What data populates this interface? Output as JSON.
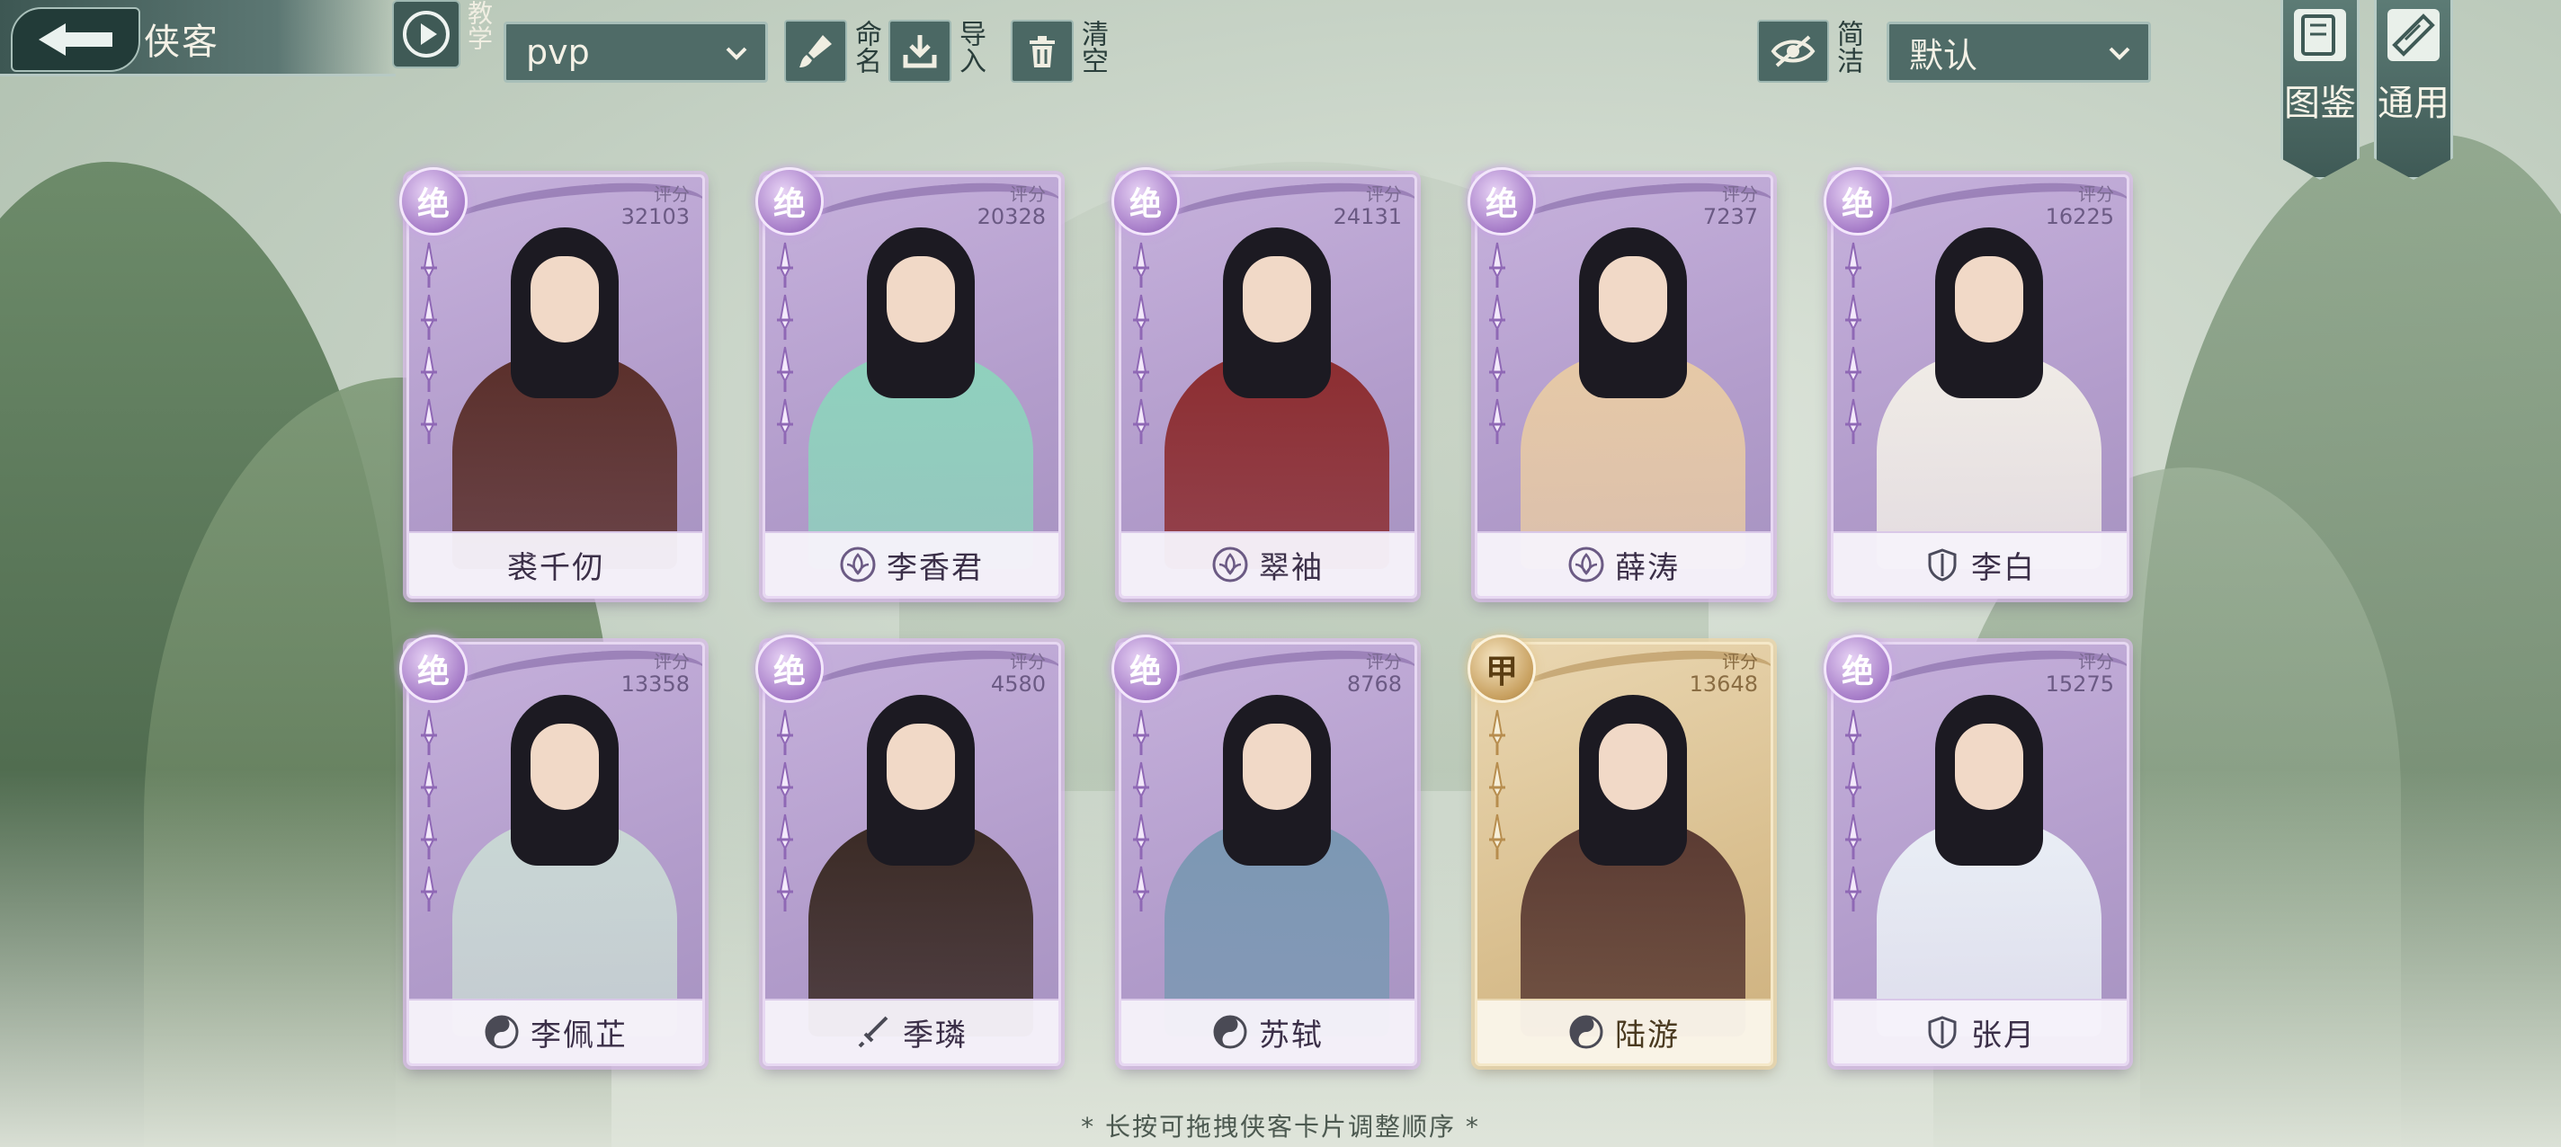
{
  "header": {
    "title": "侠客",
    "tutorial_label": "教学",
    "team_select": "pvp",
    "rename_label": "命名",
    "import_label": "导入",
    "clear_label": "清空",
    "simple_label": "简洁",
    "sort_select": "默认",
    "gallery_label": "图鉴",
    "general_label": "通用"
  },
  "colors": {
    "card_purple": "#b29ccb",
    "card_gold": "#d9bf8f",
    "toolbar_teal": "#4f6b67"
  },
  "cards": [
    {
      "name": "裘千仞",
      "score_label": "评分",
      "score": "32103",
      "rank": "绝",
      "faction_icon": "none-icon",
      "robe": "#5a2f2a"
    },
    {
      "name": "李香君",
      "score_label": "评分",
      "score": "20328",
      "rank": "绝",
      "faction_icon": "lotus-icon",
      "robe": "#8fd1bd"
    },
    {
      "name": "翠袖",
      "score_label": "评分",
      "score": "24131",
      "rank": "绝",
      "faction_icon": "lotus-icon",
      "robe": "#8c2d30"
    },
    {
      "name": "薛涛",
      "score_label": "评分",
      "score": "7237",
      "rank": "绝",
      "faction_icon": "lotus-icon",
      "robe": "#e6c9a6"
    },
    {
      "name": "李白",
      "score_label": "评分",
      "score": "16225",
      "rank": "绝",
      "faction_icon": "shield-icon",
      "robe": "#f0ece6"
    },
    {
      "name": "李佩芷",
      "score_label": "评分",
      "score": "13358",
      "rank": "绝",
      "faction_icon": "taiji-icon",
      "robe": "#c9d7d4"
    },
    {
      "name": "季璘",
      "score_label": "评分",
      "score": "4580",
      "rank": "绝",
      "faction_icon": "sword-icon",
      "robe": "#3a2a24"
    },
    {
      "name": "苏轼",
      "score_label": "评分",
      "score": "8768",
      "rank": "绝",
      "faction_icon": "taiji-icon",
      "robe": "#7b98b3"
    },
    {
      "name": "陆游",
      "score_label": "评分",
      "score": "13648",
      "rank": "甲",
      "faction_icon": "taiji-icon",
      "robe": "#5a3a32"
    },
    {
      "name": "张月",
      "score_label": "评分",
      "score": "15275",
      "rank": "绝",
      "faction_icon": "shield-icon",
      "robe": "#e9eef5"
    }
  ],
  "footer": {
    "tip": "* 长按可拖拽侠客卡片调整顺序 *"
  }
}
